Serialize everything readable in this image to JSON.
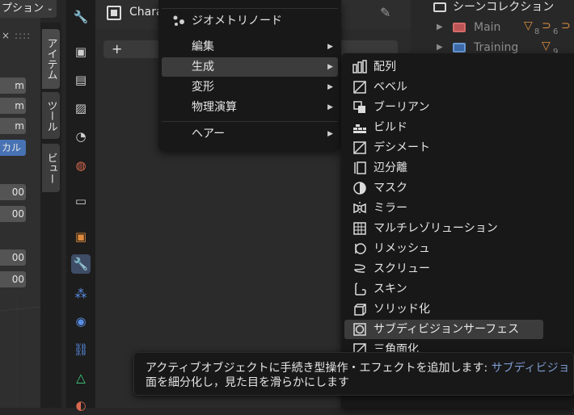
{
  "left_panel": {
    "mode_label": "プション",
    "fields": [
      "m",
      "m",
      "m",
      "カル",
      "00",
      "00",
      "00",
      "00"
    ],
    "x_label": "x",
    "dots": "::::"
  },
  "vtabs": [
    "アイテム",
    "ツール",
    "ビュー"
  ],
  "properties": {
    "object_name": "Chara",
    "add_symbol": "+"
  },
  "outliner": {
    "title": "シーンコレクション",
    "items": [
      {
        "label": "Main",
        "count_a": "8",
        "count_b": "6"
      },
      {
        "label": "Training",
        "count_a": "9",
        "count_b": ""
      }
    ]
  },
  "menu1": {
    "header": "ジオメトリノード",
    "items": [
      {
        "label": "編集",
        "has_sub": true
      },
      {
        "label": "生成",
        "has_sub": true,
        "highlight": true
      },
      {
        "label": "変形",
        "has_sub": true
      },
      {
        "label": "物理演算",
        "has_sub": true
      },
      {
        "label": "ヘアー",
        "has_sub": true
      }
    ]
  },
  "menu2": {
    "items": [
      {
        "label": "配列",
        "icon": "array-icon"
      },
      {
        "label": "ベベル",
        "icon": "bevel-icon"
      },
      {
        "label": "ブーリアン",
        "icon": "boolean-icon"
      },
      {
        "label": "ビルド",
        "icon": "build-icon"
      },
      {
        "label": "デシメート",
        "icon": "decimate-icon"
      },
      {
        "label": "辺分離",
        "icon": "edge-split-icon"
      },
      {
        "label": "マスク",
        "icon": "mask-icon"
      },
      {
        "label": "ミラー",
        "icon": "mirror-icon"
      },
      {
        "label": "マルチレゾリューション",
        "icon": "multires-icon"
      },
      {
        "label": "リメッシュ",
        "icon": "remesh-icon"
      },
      {
        "label": "スクリュー",
        "icon": "screw-icon"
      },
      {
        "label": "スキン",
        "icon": "skin-icon"
      },
      {
        "label": "ソリッド化",
        "icon": "solidify-icon"
      },
      {
        "label": "サブディビジョンサーフェス",
        "icon": "subsurf-icon",
        "highlight": true
      },
      {
        "label": "三角面化",
        "icon": "triangulate-icon"
      }
    ]
  },
  "tooltip": {
    "line1": "アクティブオブジェクトに手続き型操作・エフェクトを追加します: ",
    "operator": "サブディビジョ",
    "line2": "面を細分化し，見た目を滑らかにします"
  },
  "colors": {
    "menu_bg": "#181818",
    "highlight": "#3c3c3c",
    "accent_blue": "#4772b3",
    "tooltip_op": "#7d9bd1"
  }
}
